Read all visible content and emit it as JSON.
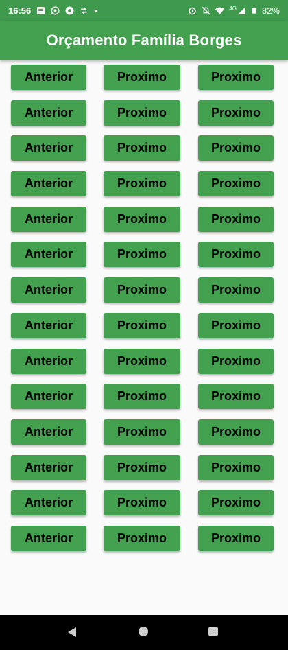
{
  "status_bar": {
    "time": "16:56",
    "dot": "•",
    "battery_percent": "82%",
    "left_icons": [
      "notes-icon",
      "whatsapp-icon",
      "chrome-icon",
      "sync-icon"
    ],
    "right_icons": [
      "alarm-icon",
      "mute-icon",
      "wifi-icon",
      "4g-signal-icon",
      "battery-icon"
    ],
    "network_label": "4G"
  },
  "app_bar": {
    "title": "Orçamento Família Borges"
  },
  "rows": [
    {
      "col1": "Anterior",
      "col2": "Proximo",
      "col3": "Proximo"
    },
    {
      "col1": "Anterior",
      "col2": "Proximo",
      "col3": "Proximo"
    },
    {
      "col1": "Anterior",
      "col2": "Proximo",
      "col3": "Proximo"
    },
    {
      "col1": "Anterior",
      "col2": "Proximo",
      "col3": "Proximo"
    },
    {
      "col1": "Anterior",
      "col2": "Proximo",
      "col3": "Proximo"
    },
    {
      "col1": "Anterior",
      "col2": "Proximo",
      "col3": "Proximo"
    },
    {
      "col1": "Anterior",
      "col2": "Proximo",
      "col3": "Proximo"
    },
    {
      "col1": "Anterior",
      "col2": "Proximo",
      "col3": "Proximo"
    },
    {
      "col1": "Anterior",
      "col2": "Proximo",
      "col3": "Proximo"
    },
    {
      "col1": "Anterior",
      "col2": "Proximo",
      "col3": "Proximo"
    },
    {
      "col1": "Anterior",
      "col2": "Proximo",
      "col3": "Proximo"
    },
    {
      "col1": "Anterior",
      "col2": "Proximo",
      "col3": "Proximo"
    },
    {
      "col1": "Anterior",
      "col2": "Proximo",
      "col3": "Proximo"
    },
    {
      "col1": "Anterior",
      "col2": "Proximo",
      "col3": "Proximo"
    }
  ],
  "nav_bar": {
    "buttons": [
      "back-icon",
      "home-icon",
      "recents-icon"
    ]
  },
  "colors": {
    "status_bar": "#3f9a4e",
    "app_bar": "#43a04f",
    "button": "#43a04f",
    "background": "#fafafa",
    "nav_bar": "#000000"
  }
}
